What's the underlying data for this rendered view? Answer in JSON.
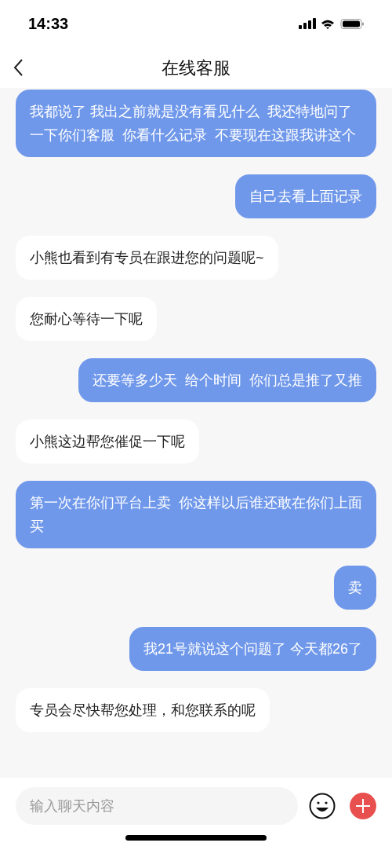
{
  "status_bar": {
    "time": "14:33"
  },
  "header": {
    "title": "在线客服"
  },
  "messages": [
    {
      "kind": "sent",
      "text": "我都说了 我出之前就是没有看见什么  我还特地问了一下你们客服  你看什么记录  不要现在这跟我讲这个"
    },
    {
      "kind": "sent",
      "text": "自己去看上面记录"
    },
    {
      "kind": "received",
      "text": "小熊也看到有专员在跟进您的问题呢~"
    },
    {
      "kind": "received",
      "text": "您耐心等待一下呢"
    },
    {
      "kind": "sent",
      "text": "还要等多少天  给个时间  你们总是推了又推"
    },
    {
      "kind": "received",
      "text": "小熊这边帮您催促一下呢"
    },
    {
      "kind": "sent",
      "text": "第一次在你们平台上卖  你这样以后谁还敢在你们上面买"
    },
    {
      "kind": "sent",
      "text": "卖"
    },
    {
      "kind": "sent",
      "text": "我21号就说这个问题了 今天都26了"
    },
    {
      "kind": "received",
      "text": "专员会尽快帮您处理，和您联系的呢"
    }
  ],
  "input": {
    "placeholder": "输入聊天内容"
  }
}
